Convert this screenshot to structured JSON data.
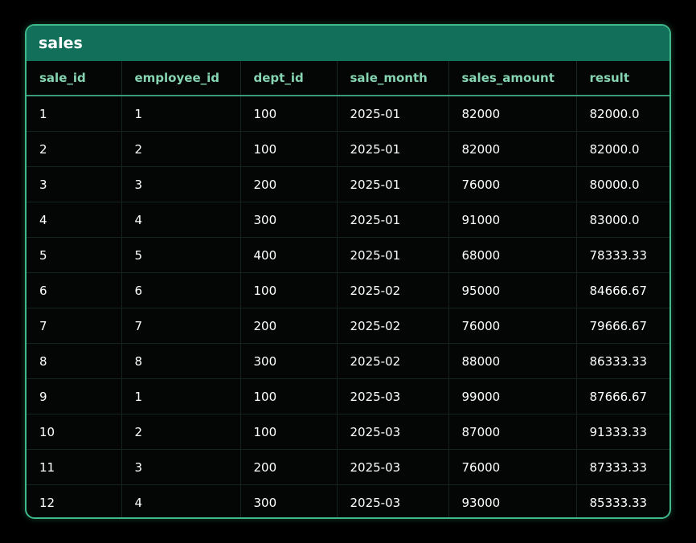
{
  "table": {
    "title": "sales",
    "columns": [
      "sale_id",
      "employee_id",
      "dept_id",
      "sale_month",
      "sales_amount",
      "result"
    ],
    "rows": [
      [
        "1",
        "1",
        "100",
        "2025-01",
        "82000",
        "82000.0"
      ],
      [
        "2",
        "2",
        "100",
        "2025-01",
        "82000",
        "82000.0"
      ],
      [
        "3",
        "3",
        "200",
        "2025-01",
        "76000",
        "80000.0"
      ],
      [
        "4",
        "4",
        "300",
        "2025-01",
        "91000",
        "83000.0"
      ],
      [
        "5",
        "5",
        "400",
        "2025-01",
        "68000",
        "78333.33"
      ],
      [
        "6",
        "6",
        "100",
        "2025-02",
        "95000",
        "84666.67"
      ],
      [
        "7",
        "7",
        "200",
        "2025-02",
        "76000",
        "79666.67"
      ],
      [
        "8",
        "8",
        "300",
        "2025-02",
        "88000",
        "86333.33"
      ],
      [
        "9",
        "1",
        "100",
        "2025-03",
        "99000",
        "87666.67"
      ],
      [
        "10",
        "2",
        "100",
        "2025-03",
        "87000",
        "91333.33"
      ],
      [
        "11",
        "3",
        "200",
        "2025-03",
        "76000",
        "87333.33"
      ],
      [
        "12",
        "4",
        "300",
        "2025-03",
        "93000",
        "85333.33"
      ]
    ]
  },
  "colors": {
    "background": "#000000",
    "border": "#3fb98a",
    "title_bar": "#12705a",
    "header_text": "#86d4b2",
    "cell_text": "#ffffff"
  }
}
